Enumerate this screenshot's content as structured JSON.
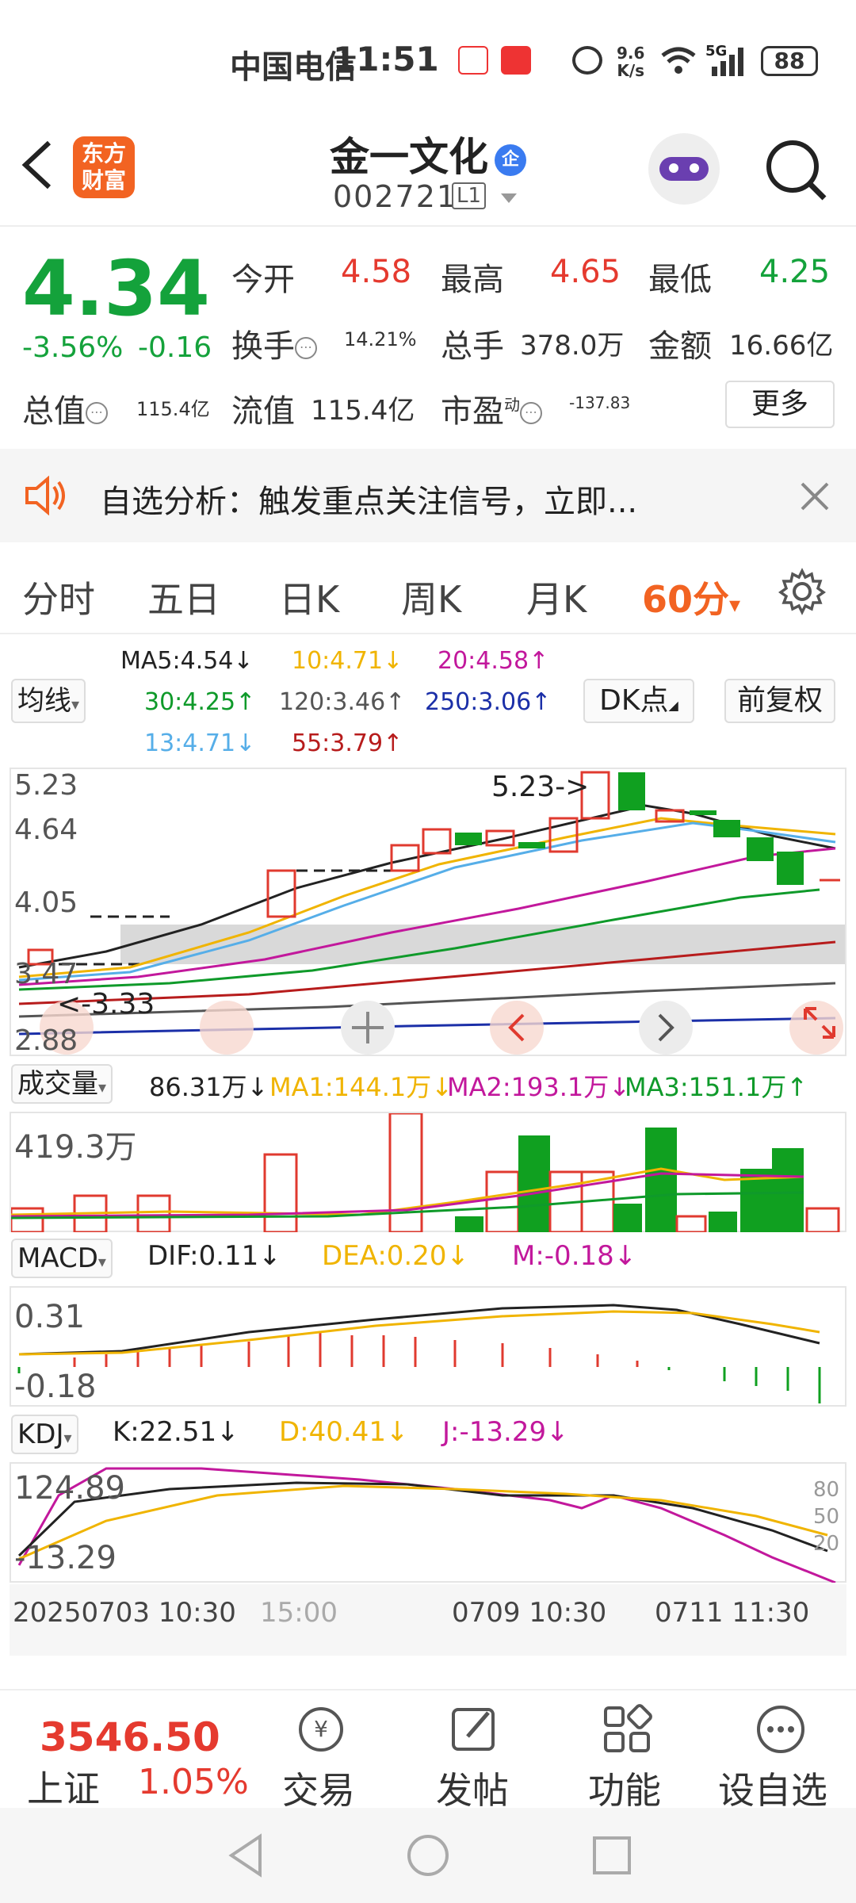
{
  "status_bar": {
    "carrier": "中国电信",
    "time": "11:51",
    "speed_top": "9.6",
    "speed_unit": "K/s",
    "network": "5G",
    "battery": "88"
  },
  "header": {
    "brand_line1": "东方",
    "brand_line2": "财富",
    "stock_name": "金一文化",
    "enterprise_badge": "企",
    "stock_code": "002721",
    "market_tag": "L1"
  },
  "quote": {
    "price": "4.34",
    "change_pct": "-3.56%",
    "change_amt": "-0.16",
    "open_label": "今开",
    "open": "4.58",
    "high_label": "最高",
    "high": "4.65",
    "low_label": "最低",
    "low": "4.25",
    "turnover_label": "换手",
    "turnover": "14.21%",
    "volume_label": "总手",
    "volume": "378.0万",
    "amount_label": "金额",
    "amount": "16.66亿",
    "mktcap_label": "总值",
    "mktcap": "115.4亿",
    "float_label": "流值",
    "float_cap": "115.4亿",
    "pe_label": "市盈",
    "pe_sup": "动",
    "pe": "-137.83",
    "more_label": "更多"
  },
  "notice": {
    "text": "自选分析：触发重点关注信号，立即..."
  },
  "tabs": {
    "items": [
      "分时",
      "五日",
      "日K",
      "周K",
      "月K"
    ],
    "active": "60分",
    "active_arrow": "▾"
  },
  "ma": {
    "selector": "均线",
    "ma5": "MA5:4.54↓",
    "ma10": "10:4.71↓",
    "ma20": "20:4.58↑",
    "ma30": "30:4.25↑",
    "ma120": "120:3.46↑",
    "ma250": "250:3.06↑",
    "ma13": "13:4.71↓",
    "ma55": "55:3.79↑",
    "dk_label": "DK点",
    "restore_label": "前复权",
    "colors": {
      "ma5": "#222222",
      "ma10": "#f0b400",
      "ma20": "#c2189c",
      "ma30": "#0f9a2a",
      "ma120": "#555555",
      "ma250": "#1b2fa8",
      "ma13": "#56aee8",
      "ma55": "#b71c1c"
    }
  },
  "kline": {
    "y_labels": [
      "5.23",
      "4.64",
      "4.05",
      "3.47",
      "2.88"
    ],
    "max_annot": "5.23->",
    "min_annot": "<-3.33"
  },
  "volume": {
    "selector": "成交量",
    "current": "86.31万↓",
    "ma1": "MA1:144.1万↓",
    "ma2": "MA2:193.1万↓",
    "ma3": "MA3:151.1万↑",
    "y_max": "419.3万"
  },
  "macd": {
    "selector": "MACD",
    "dif": "DIF:0.11↓",
    "dea": "DEA:0.20↓",
    "m": "M:-0.18↓",
    "y_top": "0.31",
    "y_bottom": "-0.18"
  },
  "kdj": {
    "selector": "KDJ",
    "k": "K:22.51↓",
    "d": "D:40.41↓",
    "j": "J:-13.29↓",
    "y_top": "124.89",
    "y_bottom": "-13.29",
    "levels": [
      "80",
      "50",
      "20"
    ]
  },
  "time_axis": {
    "t1": "20250703 10:30",
    "t1b": "15:00",
    "t2": "0709 10:30",
    "t3": "0711 11:30"
  },
  "index_bar": {
    "value": "3546.50",
    "name": "上证",
    "change": "1.05%"
  },
  "bottom_nav": {
    "trade": "交易",
    "post": "发帖",
    "function": "功能",
    "add_watch": "设自选"
  }
}
